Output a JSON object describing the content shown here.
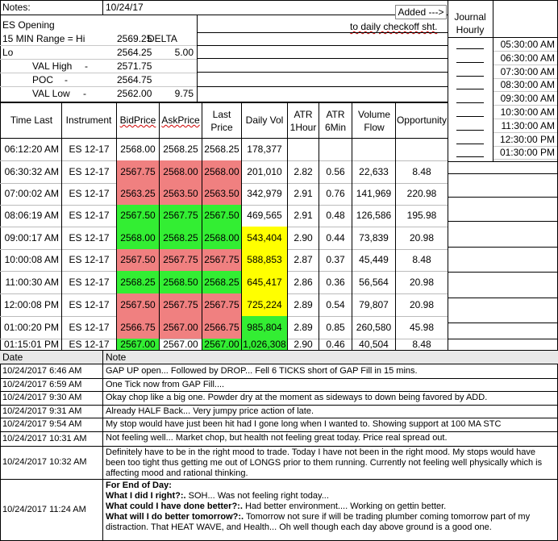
{
  "header": {
    "notes_label": "Notes:",
    "date": "10/24/17",
    "added_button": "Added --->",
    "to_checkoff": "to daily checkoff sht.",
    "journal_title_1": "Journal",
    "journal_title_2": "Hourly"
  },
  "summary": {
    "es_opening": "ES Opening",
    "range_label": "15 MIN Range = Hi",
    "range_hi": "2569.25",
    "delta_label": "DELTA",
    "lo_label": "Lo",
    "lo_value": "2564.25",
    "delta_value": "5.00",
    "val_high_label": "VAL High",
    "val_high_dash": "-",
    "val_high": "2571.75",
    "poc_label": "POC",
    "poc_dash": "-",
    "poc": "2564.75",
    "val_low_label": "VAL Low",
    "val_low_dash": "-",
    "val_low": "2562.00",
    "val_diff": "9.75"
  },
  "journal_times": [
    "05:30:00 AM",
    "06:30:00 AM",
    "07:30:00 AM",
    "08:30:00 AM",
    "09:30:00 AM",
    "10:30:00 AM",
    "11:30:00 AM",
    "12:30:00 PM",
    "01:30:00 PM"
  ],
  "table": {
    "columns": [
      "Time Last",
      "Instrument",
      "BidPrice",
      "AskPrice",
      "Last Price",
      "Daily Vol",
      "ATR 1Hour",
      "ATR 6Min",
      "Volume Flow",
      "Opportunity"
    ],
    "col_last_1": "Last",
    "col_last_2": "Price",
    "col_atr1_1": "ATR",
    "col_atr1_2": "1Hour",
    "col_atr6_1": "ATR",
    "col_atr6_2": "6Min",
    "col_vf_1": "Volume",
    "col_vf_2": "Flow",
    "rows": [
      {
        "time": "06:12:20 AM",
        "inst": "ES 12-17",
        "bid": "2568.00",
        "ask": "2568.25",
        "last": "2568.25",
        "vol": "178,377",
        "atr1": "",
        "atr6": "",
        "flow": "",
        "opp": "",
        "color": "none",
        "volcolor": "none"
      },
      {
        "time": "06:30:32 AM",
        "inst": "ES 12-17",
        "bid": "2567.75",
        "ask": "2568.00",
        "last": "2568.00",
        "vol": "201,010",
        "atr1": "2.82",
        "atr6": "0.56",
        "flow": "22,633",
        "opp": "8.48",
        "color": "red",
        "volcolor": "none"
      },
      {
        "time": "07:00:02 AM",
        "inst": "ES 12-17",
        "bid": "2563.25",
        "ask": "2563.50",
        "last": "2563.50",
        "vol": "342,979",
        "atr1": "2.91",
        "atr6": "0.76",
        "flow": "141,969",
        "opp": "220.98",
        "color": "red",
        "volcolor": "none"
      },
      {
        "time": "08:06:19 AM",
        "inst": "ES 12-17",
        "bid": "2567.50",
        "ask": "2567.75",
        "last": "2567.50",
        "vol": "469,565",
        "atr1": "2.91",
        "atr6": "0.48",
        "flow": "126,586",
        "opp": "195.98",
        "color": "green",
        "volcolor": "none"
      },
      {
        "time": "09:00:17 AM",
        "inst": "ES 12-17",
        "bid": "2568.00",
        "ask": "2568.25",
        "last": "2568.00",
        "vol": "543,404",
        "atr1": "2.90",
        "atr6": "0.44",
        "flow": "73,839",
        "opp": "20.98",
        "color": "green",
        "volcolor": "yellow"
      },
      {
        "time": "10:00:08 AM",
        "inst": "ES 12-17",
        "bid": "2567.50",
        "ask": "2567.75",
        "last": "2567.75",
        "vol": "588,853",
        "atr1": "2.87",
        "atr6": "0.37",
        "flow": "45,449",
        "opp": "8.48",
        "color": "red",
        "volcolor": "yellow"
      },
      {
        "time": "11:00:30 AM",
        "inst": "ES 12-17",
        "bid": "2568.25",
        "ask": "2568.50",
        "last": "2568.25",
        "vol": "645,417",
        "atr1": "2.86",
        "atr6": "0.36",
        "flow": "56,564",
        "opp": "20.98",
        "color": "green",
        "volcolor": "yellow"
      },
      {
        "time": "12:00:08 PM",
        "inst": "ES 12-17",
        "bid": "2567.50",
        "ask": "2567.75",
        "last": "2567.75",
        "vol": "725,224",
        "atr1": "2.89",
        "atr6": "0.54",
        "flow": "79,807",
        "opp": "20.98",
        "color": "red",
        "volcolor": "yellow"
      },
      {
        "time": "01:00:20 PM",
        "inst": "ES 12-17",
        "bid": "2566.75",
        "ask": "2567.00",
        "last": "2566.75",
        "vol": "985,804",
        "atr1": "2.89",
        "atr6": "0.85",
        "flow": "260,580",
        "opp": "45.98",
        "color": "red",
        "volcolor": "green"
      },
      {
        "time": "01:15:01 PM",
        "inst": "ES 12-17",
        "bid": "2567.00",
        "ask": "2567.00",
        "last": "2567.00",
        "vol": "1,026,308",
        "atr1": "2.90",
        "atr6": "0.46",
        "flow": "40,504",
        "opp": "8.48",
        "color": "mixed",
        "volcolor": "green"
      }
    ]
  },
  "notes_table": {
    "col_date": "Date",
    "col_note": "Note",
    "rows": [
      {
        "date": "10/24/2017 6:46 AM",
        "note": "GAP UP open... Followed by DROP... Fell 6 TICKS short of GAP Fill in 15 mins."
      },
      {
        "date": "10/24/2017 6:59 AM",
        "note": "One Tick now from GAP Fill...."
      },
      {
        "date": "10/24/2017 9:30 AM",
        "note": "Okay chop like a big one.  Powder dry at the moment as sideways to down being favored by ADD."
      },
      {
        "date": "10/24/2017 9:31 AM",
        "note": "Already HALF Back... Very jumpy price action of late."
      },
      {
        "date": "10/24/2017 9:54 AM",
        "note": "My stop would have just been hit had I gone long when I wanted to.  Showing support at 100 MA STC"
      },
      {
        "date": "10/24/2017 10:31 AM",
        "note": "Not feeling well... Market chop, but health not feeling great today.  Price real spread out."
      },
      {
        "date": "10/24/2017 10:32 AM",
        "note": "Definitely have to be in the right mood to trade.  Today I have not been in the right mood.  My stops would have been too tight thus getting me out of LONGS prior to them running.  Currently not feeling well physically which is affecting mood and rational thinking."
      },
      {
        "date": "10/24/2017 11:24 AM",
        "end_title": "For End of Day:",
        "q1": "What I did I right?:.",
        "a1": "  SOH... Was not feeling right today...",
        "q2": "What could I have done better?:.",
        "a2": "  Had better environment.... Working on gettin better.",
        "q3": "What will I do better tomorrow?:.",
        "a3": "  Tomorrow not sure if will be trading plumber coming tomorrow part of my distraction.  That HEAT WAVE, and Health... Oh well though each day above ground is a good one."
      }
    ]
  },
  "colors": {
    "red": "#f08080",
    "green": "#33ee33",
    "yellow": "#ffff00"
  }
}
